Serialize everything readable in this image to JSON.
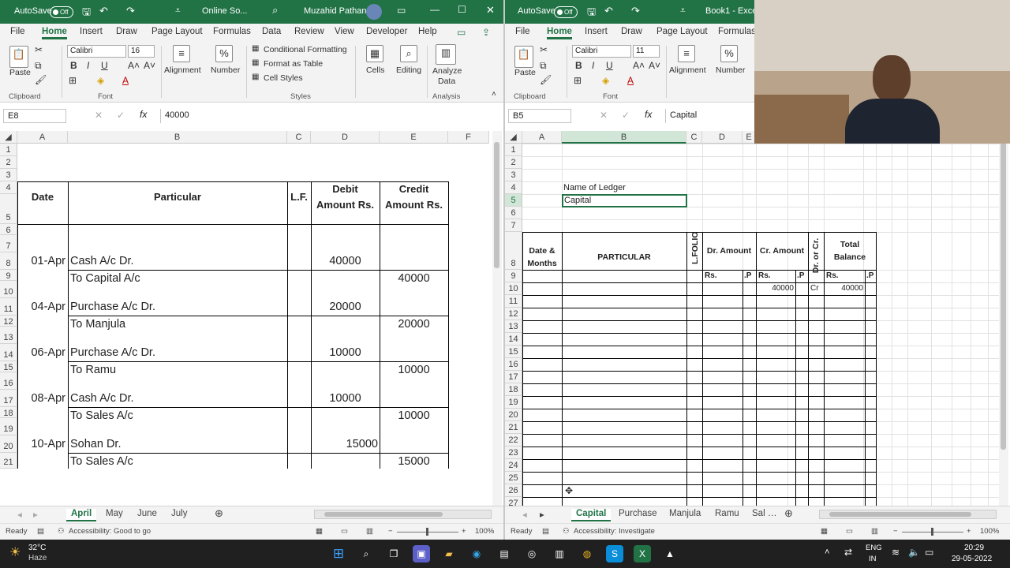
{
  "w1": {
    "autosave": "AutoSave",
    "autosave_state": "Off",
    "title": "Online So...",
    "user": "Muzahid Pathan",
    "tabs": [
      "File",
      "Home",
      "Insert",
      "Draw",
      "Page Layout",
      "Formulas",
      "Data",
      "Review",
      "View",
      "Developer",
      "Help"
    ],
    "ribbon": {
      "paste": "Paste",
      "clipboard": "Clipboard",
      "font_name": "Calibri",
      "font_size": "16",
      "font": "Font",
      "alignment": "Alignment",
      "number": "Number",
      "cond": "Conditional Formatting",
      "fmt_table": "Format as Table",
      "cell_styles": "Cell Styles",
      "styles": "Styles",
      "cells": "Cells",
      "editing": "Editing",
      "analyze": "Analyze",
      "analyze2": "Data",
      "analysis": "Analysis"
    },
    "name_box": "E8",
    "formula": "40000",
    "cols": [
      "A",
      "B",
      "C",
      "D",
      "E",
      "F"
    ],
    "rows": [
      "1",
      "2",
      "3",
      "4",
      "5",
      "6",
      "7",
      "8",
      "9",
      "10",
      "11",
      "12",
      "13",
      "14",
      "15",
      "16",
      "17",
      "18",
      "19",
      "20",
      "21"
    ],
    "headers": {
      "date": "Date",
      "particular": "Particular",
      "lf": "L.F.",
      "debit1": "Debit",
      "debit2": "Amount Rs.",
      "credit1": "Credit",
      "credit2": "Amount Rs."
    },
    "entries": [
      {
        "date": "01-Apr",
        "dr": "Cash A/c Dr.",
        "cr": "To Capital A/c",
        "debit": "40000",
        "credit": "40000"
      },
      {
        "date": "04-Apr",
        "dr": "Purchase A/c Dr.",
        "cr": "To Manjula",
        "debit": "20000",
        "credit": "20000"
      },
      {
        "date": "06-Apr",
        "dr": "Purchase A/c Dr.",
        "cr": "To Ramu",
        "debit": "10000",
        "credit": "10000"
      },
      {
        "date": "08-Apr",
        "dr": "Cash A/c Dr.",
        "cr": "To Sales A/c",
        "debit": "10000",
        "credit": "10000"
      },
      {
        "date": "10-Apr",
        "dr": "Sohan Dr.",
        "cr": "To Sales A/c",
        "debit": "15000",
        "credit": "15000"
      }
    ],
    "sheets": [
      "April",
      "May",
      "June",
      "July"
    ],
    "status": {
      "ready": "Ready",
      "access": "Accessibility: Good to go",
      "zoom": "100%"
    }
  },
  "w2": {
    "autosave": "AutoSave",
    "autosave_state": "Off",
    "title": "Book1 - Excel",
    "tabs": [
      "File",
      "Home",
      "Insert",
      "Draw",
      "Page Layout",
      "Formulas"
    ],
    "ribbon": {
      "paste": "Paste",
      "clipboard": "Clipboard",
      "font_name": "Calibri",
      "font_size": "11",
      "font": "Font",
      "alignment": "Alignment",
      "number": "Number"
    },
    "name_box": "B5",
    "formula": "Capital",
    "cols": [
      "A",
      "B",
      "C",
      "D",
      "E"
    ],
    "rows": [
      "1",
      "2",
      "3",
      "4",
      "5",
      "6",
      "7",
      "8",
      "9",
      "10",
      "11",
      "12",
      "13",
      "14",
      "15",
      "16",
      "17",
      "18",
      "19",
      "20",
      "21",
      "22",
      "23",
      "24",
      "25",
      "26",
      "27"
    ],
    "ledger_label": "Name of Ledger",
    "ledger_name": "Capital",
    "hdr": {
      "date1": "Date &",
      "date2": "Months",
      "particular": "PARTICULAR",
      "lfolio": "L.FOLIO",
      "dr": "Dr. Amount",
      "cr": "Cr. Amount",
      "drcr": "Dr. or Cr.",
      "total1": "Total",
      "total2": "Balance",
      "rs1": "Rs.",
      "p1": ".P",
      "rs2": "Rs.",
      "p2": ".P",
      "rs3": "Rs.",
      "p3": ".P"
    },
    "row10": {
      "cr": "40000",
      "drcr": "Cr",
      "total": "40000"
    },
    "sheets": [
      "Capital",
      "Purchase",
      "Manjula",
      "Ramu",
      "Sal"
    ],
    "status": {
      "ready": "Ready",
      "access": "Accessibility: Investigate",
      "zoom": "100%"
    }
  },
  "taskbar": {
    "temp": "32°C",
    "weather": "Haze",
    "lang1": "ENG",
    "lang2": "IN",
    "time": "20:29",
    "date": "29-05-2022"
  },
  "colors": {
    "excel_green": "#217346",
    "taskbar": "#202020"
  }
}
